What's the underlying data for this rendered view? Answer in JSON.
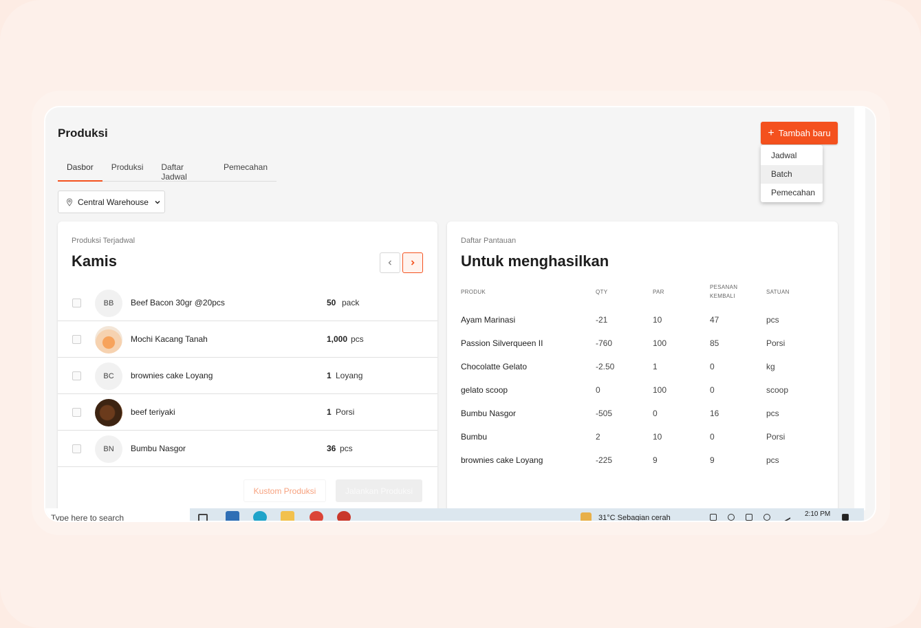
{
  "page": {
    "title": "Produksi"
  },
  "add_button": {
    "label": "Tambah baru",
    "icon": "plus-icon"
  },
  "add_menu": [
    "Jadwal",
    "Batch",
    "Pemecahan"
  ],
  "tabs": [
    {
      "label": "Dasbor",
      "active": true
    },
    {
      "label": "Produksi",
      "active": false
    },
    {
      "label": "Daftar Jadwal",
      "active": false
    },
    {
      "label": "Pemecahan",
      "active": false
    }
  ],
  "warehouse": {
    "label": "Central Warehouse",
    "icon": "location-pin-icon"
  },
  "scheduled": {
    "subtitle": "Produksi Terjadwal",
    "day": "Kamis",
    "items": [
      {
        "initials": "BB",
        "name": "Beef Bacon 30gr @20pcs",
        "qty": "50",
        "unit": "pack"
      },
      {
        "initials": "",
        "name": "Mochi Kacang Tanah",
        "qty": "1,000",
        "unit": "pcs"
      },
      {
        "initials": "BC",
        "name": "brownies cake Loyang",
        "qty": "1",
        "unit": "Loyang"
      },
      {
        "initials": "",
        "name": "beef teriyaki",
        "qty": "1",
        "unit": "Porsi"
      },
      {
        "initials": "BN",
        "name": "Bumbu Nasgor",
        "qty": "36",
        "unit": "pcs"
      }
    ],
    "custom_button": "Kustom Produksi",
    "run_button": "Jalankan Produksi"
  },
  "watchlist": {
    "subtitle": "Daftar Pantauan",
    "title": "Untuk menghasilkan",
    "columns": {
      "product": "PRODUK",
      "qty": "QTY",
      "par": "PAR",
      "return_1": "PESANAN",
      "return_2": "KEMBALI",
      "unit": "SATUAN"
    },
    "rows": [
      {
        "product": "Ayam Marinasi",
        "qty": "-21",
        "par": "10",
        "return": "47",
        "unit": "pcs"
      },
      {
        "product": "Passion Silverqueen II",
        "qty": "-760",
        "par": "100",
        "return": "85",
        "unit": "Porsi"
      },
      {
        "product": "Chocolatte Gelato",
        "qty": "-2.50",
        "par": "1",
        "return": "0",
        "unit": "kg"
      },
      {
        "product": "gelato scoop",
        "qty": "0",
        "par": "100",
        "return": "0",
        "unit": "scoop"
      },
      {
        "product": "Bumbu Nasgor",
        "qty": "-505",
        "par": "0",
        "return": "16",
        "unit": "pcs"
      },
      {
        "product": "Bumbu",
        "qty": "2",
        "par": "10",
        "return": "0",
        "unit": "Porsi"
      },
      {
        "product": "brownies cake Loyang",
        "qty": "-225",
        "par": "9",
        "return": "9",
        "unit": "pcs"
      }
    ]
  },
  "taskbar": {
    "search_placeholder": "Type here to search",
    "weather": "31°C  Sebagian cerah",
    "time": "2:10 PM"
  },
  "colors": {
    "accent": "#f4511e",
    "background": "#fdece4"
  }
}
